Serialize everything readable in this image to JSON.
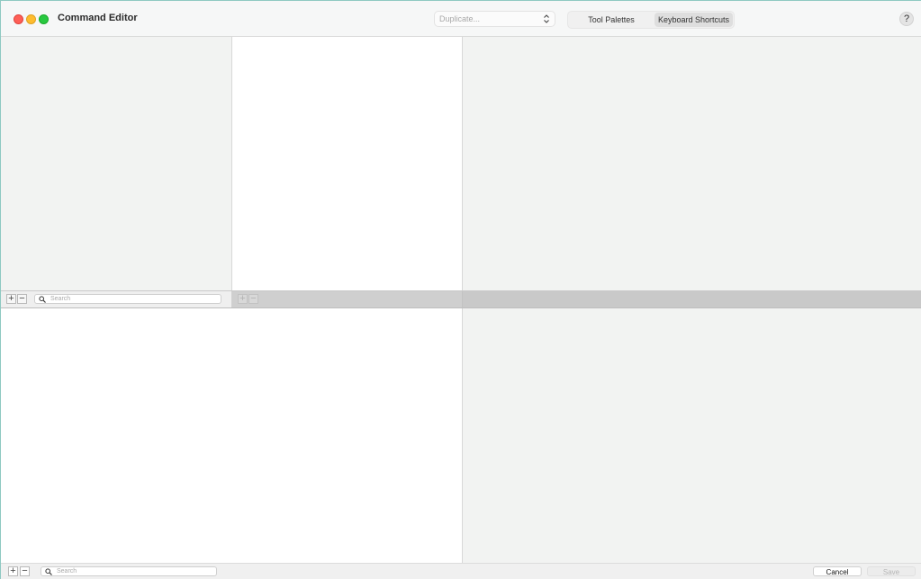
{
  "window": {
    "title": "Command Editor"
  },
  "toolbar": {
    "duplicate_placeholder": "Duplicate...",
    "segments": [
      {
        "label": "Tool Palettes",
        "selected": false
      },
      {
        "label": "Keyboard Shortcuts",
        "selected": true
      }
    ],
    "help_label": "?"
  },
  "top_bar": {
    "add_label": "+",
    "remove_label": "−",
    "search_placeholder": "Search",
    "mid_add_label": "+",
    "mid_remove_label": "−"
  },
  "bottom_bar": {
    "add_label": "+",
    "remove_label": "−",
    "search_placeholder": "Search",
    "cancel_label": "Cancel",
    "save_label": "Save"
  },
  "colors": {
    "close": "#fe5f57",
    "minimize": "#febc2e",
    "maximize": "#28c840"
  }
}
